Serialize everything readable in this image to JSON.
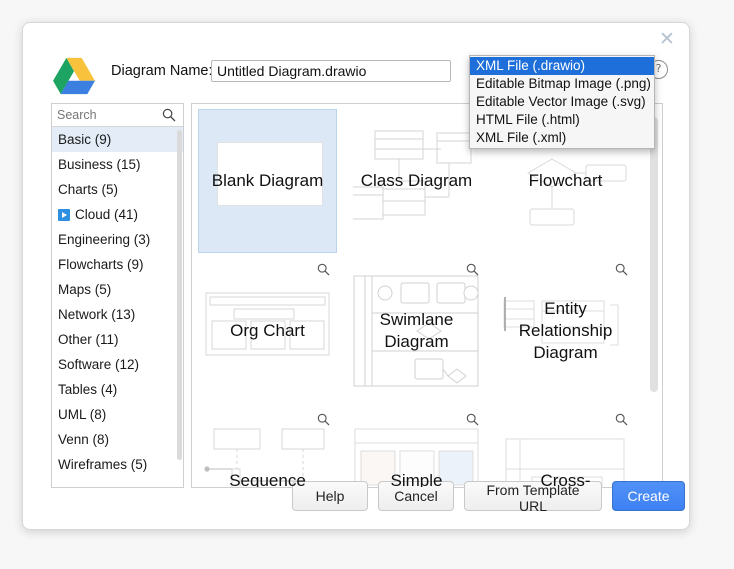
{
  "dialog": {
    "close_label": "✕",
    "logo_name": "google-drive-logo",
    "diagram_name_label": "Diagram Name:",
    "diagram_name_value": "Untitled Diagram.drawio",
    "diagram_name_placeholder": "Untitled Diagram.drawio",
    "help_icon_label": "?"
  },
  "format_select": {
    "selected": "XML File (.drawio)",
    "expanded": true,
    "options": [
      "XML File (.drawio)",
      "Editable Bitmap Image (.png)",
      "Editable Vector Image (.svg)",
      "HTML File (.html)",
      "XML File (.xml)"
    ],
    "highlight_color": "#1e6fd9"
  },
  "sidebar": {
    "search_placeholder": "Search",
    "search_value": "",
    "search_icon": "search-icon",
    "items": [
      {
        "label": "Basic (9)",
        "selected": true,
        "expandable": false
      },
      {
        "label": "Business (15)",
        "selected": false,
        "expandable": false
      },
      {
        "label": "Charts (5)",
        "selected": false,
        "expandable": false
      },
      {
        "label": "Cloud (41)",
        "selected": false,
        "expandable": true
      },
      {
        "label": "Engineering (3)",
        "selected": false,
        "expandable": false
      },
      {
        "label": "Flowcharts (9)",
        "selected": false,
        "expandable": false
      },
      {
        "label": "Maps (5)",
        "selected": false,
        "expandable": false
      },
      {
        "label": "Network (13)",
        "selected": false,
        "expandable": false
      },
      {
        "label": "Other (11)",
        "selected": false,
        "expandable": false
      },
      {
        "label": "Software (12)",
        "selected": false,
        "expandable": false
      },
      {
        "label": "Tables (4)",
        "selected": false,
        "expandable": false
      },
      {
        "label": "UML (8)",
        "selected": false,
        "expandable": false
      },
      {
        "label": "Venn (8)",
        "selected": false,
        "expandable": false
      },
      {
        "label": "Wireframes (5)",
        "selected": false,
        "expandable": false
      }
    ]
  },
  "templates": [
    {
      "name": "Blank Diagram",
      "selected": true,
      "zoom_icon": false
    },
    {
      "name": "Class Diagram",
      "selected": false,
      "zoom_icon": false
    },
    {
      "name": "Flowchart",
      "selected": false,
      "zoom_icon": false
    },
    {
      "name": "Org Chart",
      "selected": false,
      "zoom_icon": true
    },
    {
      "name": "Swimlane Diagram",
      "selected": false,
      "zoom_icon": true
    },
    {
      "name": "Entity Relationship Diagram",
      "selected": false,
      "zoom_icon": true
    },
    {
      "name": "Sequence",
      "selected": false,
      "zoom_icon": true
    },
    {
      "name": "Simple",
      "selected": false,
      "zoom_icon": true
    },
    {
      "name": "Cross-",
      "selected": false,
      "zoom_icon": true
    }
  ],
  "footer": {
    "help": "Help",
    "cancel": "Cancel",
    "from_template_url": "From Template URL",
    "create": "Create",
    "create_color": "#4286f5"
  }
}
